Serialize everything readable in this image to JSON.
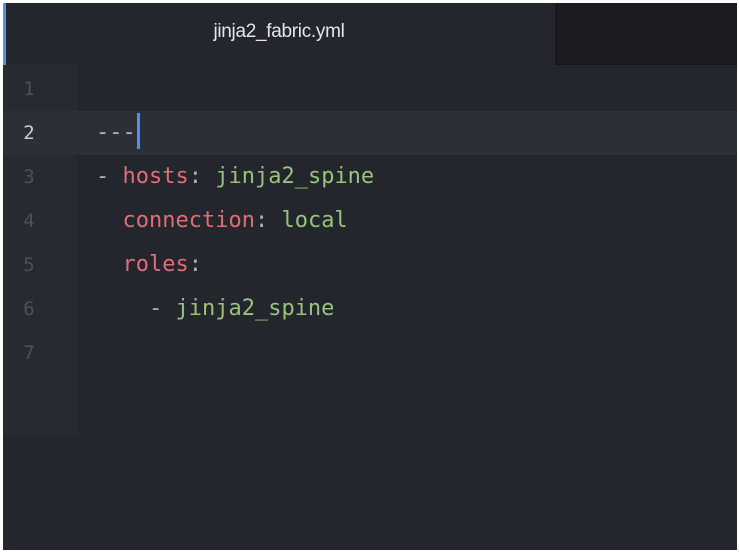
{
  "tabs": [
    {
      "label": "jinja2_fabric.yml",
      "active": true
    }
  ],
  "editor": {
    "current_line": 2,
    "lines": [
      {
        "number": "1",
        "segments": []
      },
      {
        "number": "2",
        "segments": [
          {
            "text": "---",
            "role": "punct"
          }
        ]
      },
      {
        "number": "3",
        "segments": [
          {
            "text": "- ",
            "role": "punct"
          },
          {
            "text": "hosts",
            "role": "key"
          },
          {
            "text": ": ",
            "role": "punct"
          },
          {
            "text": "jinja2_spine",
            "role": "value"
          }
        ]
      },
      {
        "number": "4",
        "segments": [
          {
            "text": "  ",
            "role": "punct"
          },
          {
            "text": "connection",
            "role": "key"
          },
          {
            "text": ": ",
            "role": "punct"
          },
          {
            "text": "local",
            "role": "value"
          }
        ]
      },
      {
        "number": "5",
        "segments": [
          {
            "text": "  ",
            "role": "punct"
          },
          {
            "text": "roles",
            "role": "key"
          },
          {
            "text": ":",
            "role": "punct"
          }
        ]
      },
      {
        "number": "6",
        "segments": [
          {
            "text": "    - ",
            "role": "punct"
          },
          {
            "text": "jinja2_spine",
            "role": "value"
          }
        ]
      },
      {
        "number": "7",
        "segments": []
      }
    ]
  },
  "colors": {
    "background": "#23262d",
    "key": "#e06c75",
    "value": "#98c379",
    "punct": "#abb2bf",
    "cursor": "#528bff",
    "tab_accent": "#5c8fd6"
  }
}
